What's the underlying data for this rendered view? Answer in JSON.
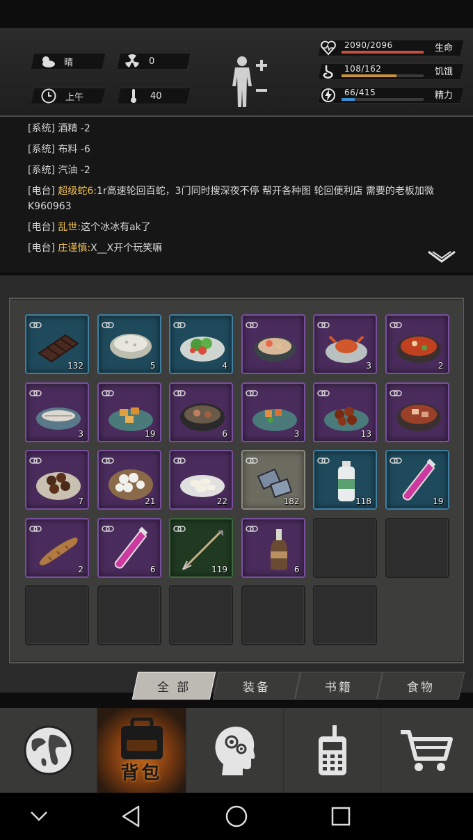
{
  "status": {
    "weather": "晴",
    "radiation": "0",
    "time_of_day": "上午",
    "temperature": "40",
    "health": {
      "text": "2090/2096",
      "label": "生命",
      "value": 2090,
      "max": 2096,
      "color": "#c8503c"
    },
    "hunger": {
      "text": "108/162",
      "label": "饥饿",
      "value": 108,
      "max": 162,
      "color": "#c8943c"
    },
    "energy": {
      "text": "66/415",
      "label": "精力",
      "value": 66,
      "max": 415,
      "color": "#3c8cd0"
    }
  },
  "log": [
    {
      "prefix": "[系统]",
      "user": "",
      "message": "酒精 -2"
    },
    {
      "prefix": "[系统]",
      "user": "",
      "message": "布料 -6"
    },
    {
      "prefix": "[系统]",
      "user": "",
      "message": "汽油 -2"
    },
    {
      "prefix": "[电台]",
      "user": "超级蛇6:",
      "message": "1r高速轮回百蛇，3门同时搜深夜不停 帮开各种图 轮回便利店 需要的老板加微K960963"
    },
    {
      "prefix": "[电台]",
      "user": "乱世:",
      "message": "这个冰冰有ak了"
    },
    {
      "prefix": "[电台]",
      "user": "庄谨慎:",
      "message": "X__X开个玩笑嘛"
    }
  ],
  "inventory": {
    "rows": [
      [
        {
          "rarity": "blue",
          "icon": "chocolate-icon",
          "count": "132"
        },
        {
          "rarity": "blue",
          "icon": "porridge-bowl-icon",
          "count": "5"
        },
        {
          "rarity": "blue",
          "icon": "salad-plate-icon",
          "count": "4"
        },
        {
          "rarity": "purple",
          "icon": "seafood-soup-icon",
          "count": ""
        },
        {
          "rarity": "purple",
          "icon": "crab-plate-icon",
          "count": "3"
        },
        {
          "rarity": "purple",
          "icon": "spicy-hotpot-icon",
          "count": "2"
        }
      ],
      [
        {
          "rarity": "purple",
          "icon": "fish-fillet-icon",
          "count": "3"
        },
        {
          "rarity": "purple",
          "icon": "fried-tofu-icon",
          "count": "19"
        },
        {
          "rarity": "purple",
          "icon": "stew-pot-icon",
          "count": "6"
        },
        {
          "rarity": "purple",
          "icon": "kungpao-dish-icon",
          "count": "3"
        },
        {
          "rarity": "purple",
          "icon": "meatballs-icon",
          "count": "13"
        },
        {
          "rarity": "purple",
          "icon": "braised-pork-icon",
          "count": ""
        }
      ],
      [
        {
          "rarity": "purple",
          "icon": "chestnuts-bowl-icon",
          "count": "7"
        },
        {
          "rarity": "purple",
          "icon": "dumpling-basket-icon",
          "count": "21"
        },
        {
          "rarity": "purple",
          "icon": "dumplings-plate-icon",
          "count": "22"
        },
        {
          "rarity": "grey",
          "icon": "cloth-scraps-icon",
          "count": "182"
        },
        {
          "rarity": "blue",
          "icon": "water-bottle-icon",
          "count": "118"
        },
        {
          "rarity": "blue",
          "icon": "pink-vial-icon",
          "count": "19"
        }
      ],
      [
        {
          "rarity": "purple",
          "icon": "baguette-icon",
          "count": "2"
        },
        {
          "rarity": "purple",
          "icon": "pink-vial-icon",
          "count": "6"
        },
        {
          "rarity": "green",
          "icon": "arrow-icon",
          "count": "119"
        },
        {
          "rarity": "purple",
          "icon": "molotov-icon",
          "count": "6"
        },
        {
          "rarity": "empty",
          "icon": "",
          "count": ""
        },
        {
          "rarity": "empty",
          "icon": "",
          "count": ""
        }
      ],
      [
        {
          "rarity": "empty",
          "icon": "",
          "count": ""
        },
        {
          "rarity": "empty",
          "icon": "",
          "count": ""
        },
        {
          "rarity": "empty",
          "icon": "",
          "count": ""
        },
        {
          "rarity": "empty",
          "icon": "",
          "count": ""
        },
        {
          "rarity": "empty",
          "icon": "",
          "count": ""
        }
      ]
    ]
  },
  "tabs": [
    {
      "label": "全 部",
      "active": true
    },
    {
      "label": "装备",
      "active": false
    },
    {
      "label": "书籍",
      "active": false
    },
    {
      "label": "食物",
      "active": false
    }
  ],
  "nav": {
    "backpack_label": "背包",
    "items": [
      "globe-icon",
      "backpack-icon",
      "brain-icon",
      "radio-icon",
      "cart-icon"
    ]
  }
}
